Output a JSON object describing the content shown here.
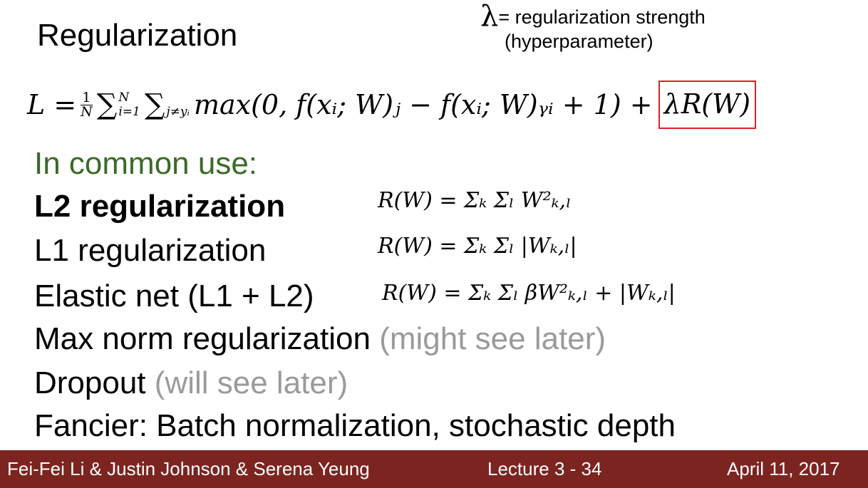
{
  "title": "Regularization",
  "lambda_note": {
    "symbol": "λ",
    "line1": "= regularization strength",
    "line2": "(hyperparameter)"
  },
  "loss": {
    "lhs": "L =",
    "frac_num": "1",
    "frac_den": "N",
    "sum1_upper": "N",
    "sum1_lower": "i=1",
    "sum2_lower": "j≠yᵢ",
    "body": "max(0, f(xᵢ; W)ⱼ − f(xᵢ; W)ᵧᵢ + 1) +",
    "reg_term": "λR(W)"
  },
  "list": {
    "heading": "In common use:",
    "items": [
      {
        "label": "L2 regularization",
        "formula": "R(W) = Σₖ Σₗ W²ₖ,ₗ"
      },
      {
        "label": "L1 regularization",
        "formula": "R(W) = Σₖ Σₗ |Wₖ,ₗ|"
      },
      {
        "label": "Elastic net (L1 + L2)",
        "formula": "R(W) = Σₖ Σₗ βW²ₖ,ₗ + |Wₖ,ₗ|"
      },
      {
        "label": "Max norm regularization",
        "note": "(might see later)"
      },
      {
        "label": "Dropout",
        "note": "(will see later)"
      },
      {
        "label": "Fancier: Batch normalization, stochastic depth"
      }
    ]
  },
  "footer": {
    "authors": "Fei-Fei Li & Justin Johnson & Serena Yeung",
    "lecture": "Lecture 3 -  34",
    "date": "April 11, 2017"
  },
  "colors": {
    "heading": "#3a6b26",
    "note": "#9a9a9a",
    "highlight_box": "#e02020",
    "footer_bg": "#7b2420"
  }
}
